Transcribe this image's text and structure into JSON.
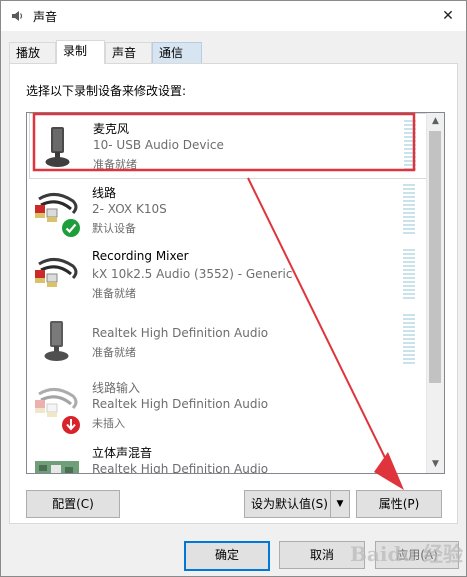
{
  "window": {
    "title": "声音",
    "close_glyph": "✕"
  },
  "tabs": [
    {
      "label": "播放"
    },
    {
      "label": "录制"
    },
    {
      "label": "声音"
    },
    {
      "label": "通信"
    }
  ],
  "panel": {
    "header": "选择以下录制设备来修改设置:"
  },
  "devices": [
    {
      "name": "麦克风",
      "description": "10- USB Audio Device",
      "status": "准备就绪",
      "icon": "microphone-icon",
      "selected": true
    },
    {
      "name": "线路",
      "description": "2- XOX K10S",
      "status": "默认设备",
      "icon": "line-in-icon",
      "badge": "default-checkmark-icon"
    },
    {
      "name": "Recording Mixer",
      "description": "kX 10k2.5 Audio (3552) - Generic",
      "status": "准备就绪",
      "icon": "line-in-icon"
    },
    {
      "name": "",
      "description": "Realtek High Definition Audio",
      "status": "准备就绪",
      "icon": "microphone-icon",
      "disabled": true
    },
    {
      "name": "线路输入",
      "description": "Realtek High Definition Audio",
      "status": "未插入",
      "icon": "line-in-icon",
      "badge": "unplugged-arrow-icon",
      "disabled": true
    },
    {
      "name": "立体声混音",
      "description": "Realtek High Definition Audio",
      "status": "",
      "icon": "sound-card-icon"
    }
  ],
  "buttons": {
    "configure": "配置(C)",
    "set_default": "设为默认值(S)",
    "properties": "属性(P)",
    "ok": "确定",
    "cancel": "取消",
    "apply": "应用(A)"
  },
  "watermark": "Baidu 经验",
  "colors": {
    "highlight_red": "#e0343c",
    "accent_blue": "#0078d7",
    "check_green": "#1e9e3a"
  }
}
